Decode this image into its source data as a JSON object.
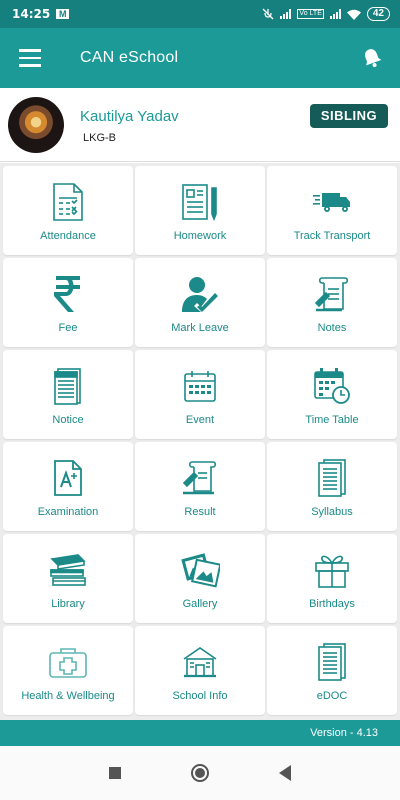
{
  "status_bar": {
    "time": "14:25",
    "volte": "Vo LTE",
    "battery": "42"
  },
  "app_bar": {
    "title": "CAN eSchool"
  },
  "profile": {
    "name": "Kautilya Yadav",
    "class": "LKG-B",
    "sibling_label": "SIBLING"
  },
  "menu": {
    "items": [
      {
        "label": "Attendance",
        "icon": "attendance-icon"
      },
      {
        "label": "Homework",
        "icon": "homework-icon"
      },
      {
        "label": "Track Transport",
        "icon": "transport-icon"
      },
      {
        "label": "Fee",
        "icon": "rupee-icon"
      },
      {
        "label": "Mark Leave",
        "icon": "mark-leave-icon"
      },
      {
        "label": "Notes",
        "icon": "notes-icon"
      },
      {
        "label": "Notice",
        "icon": "notice-icon"
      },
      {
        "label": "Event",
        "icon": "event-icon"
      },
      {
        "label": "Time Table",
        "icon": "timetable-icon"
      },
      {
        "label": "Examination",
        "icon": "examination-icon"
      },
      {
        "label": "Result",
        "icon": "result-icon"
      },
      {
        "label": "Syllabus",
        "icon": "syllabus-icon"
      },
      {
        "label": "Library",
        "icon": "library-icon"
      },
      {
        "label": "Gallery",
        "icon": "gallery-icon"
      },
      {
        "label": "Birthdays",
        "icon": "birthday-gift-icon"
      },
      {
        "label": "Health & Wellbeing",
        "icon": "health-kit-icon"
      },
      {
        "label": "School Info",
        "icon": "school-icon"
      },
      {
        "label": "eDOC",
        "icon": "edoc-icon"
      }
    ]
  },
  "footer": {
    "version": "Version - 4.13"
  },
  "colors": {
    "primary": "#1b9a98",
    "status_bar": "#16807f",
    "sibling_button": "#155b57",
    "icon": "#1b8a88"
  }
}
